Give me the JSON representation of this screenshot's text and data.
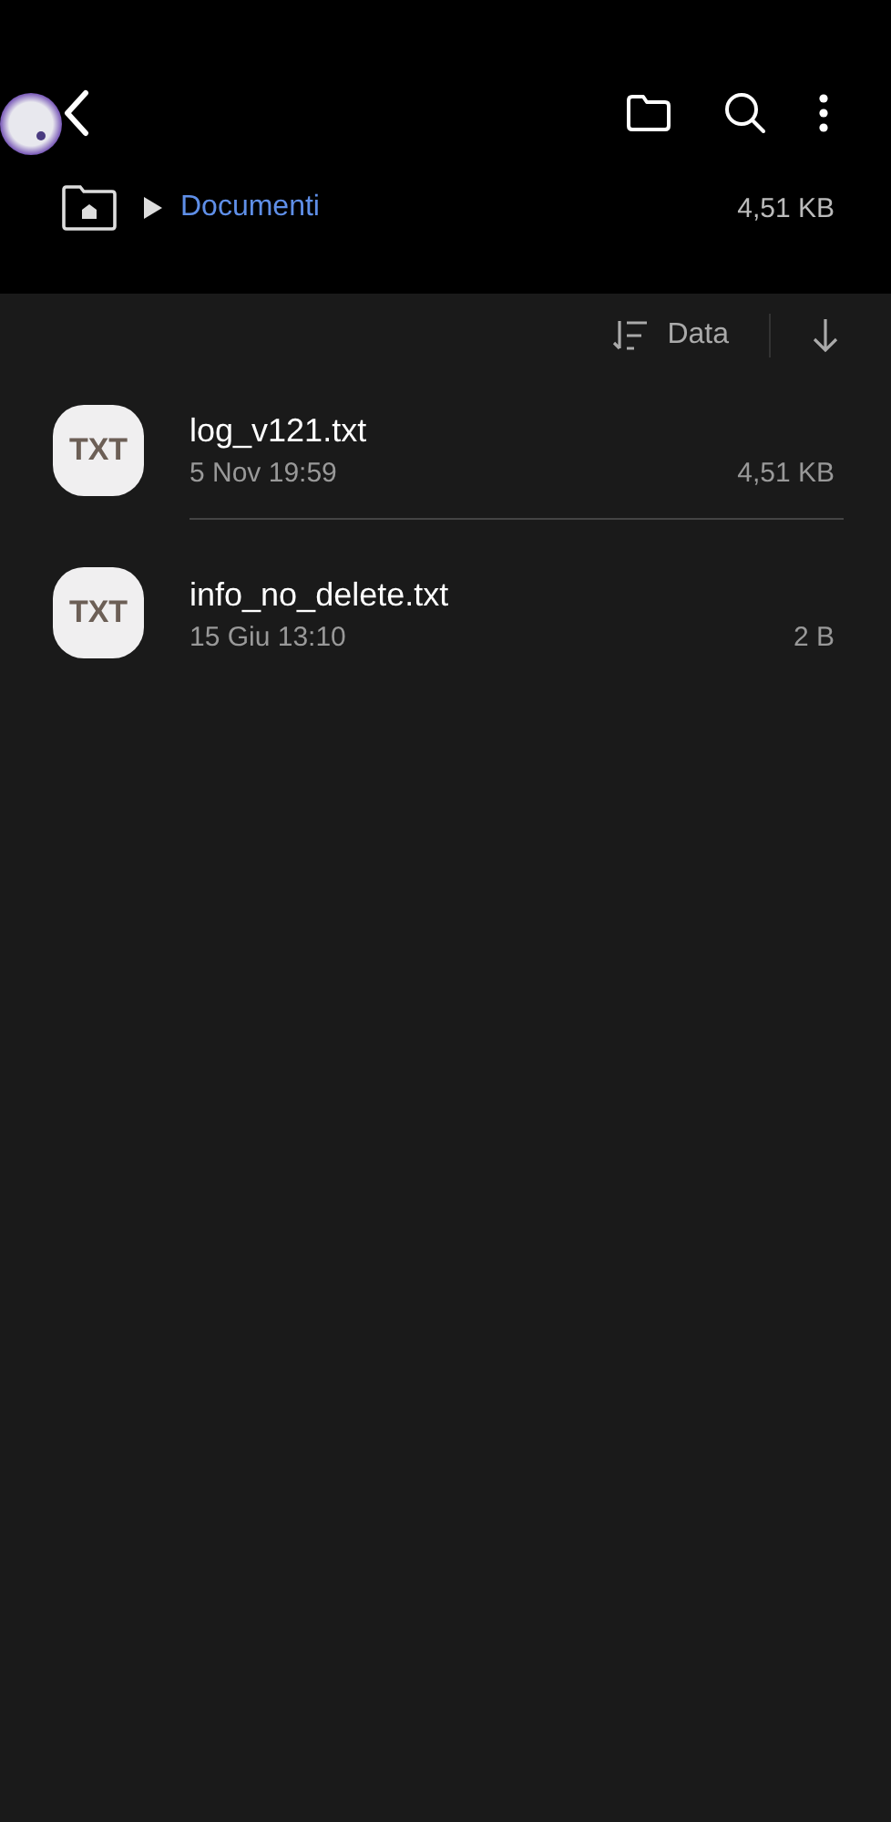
{
  "breadcrumb": {
    "folder": "Documenti",
    "size": "4,51 KB"
  },
  "sort": {
    "label": "Data"
  },
  "files": [
    {
      "badge": "TXT",
      "name": "log_v121.txt",
      "date": "5 Nov 19:59",
      "size": "4,51 KB"
    },
    {
      "badge": "TXT",
      "name": "info_no_delete.txt",
      "date": "15 Giu 13:10",
      "size": "2 B"
    }
  ]
}
